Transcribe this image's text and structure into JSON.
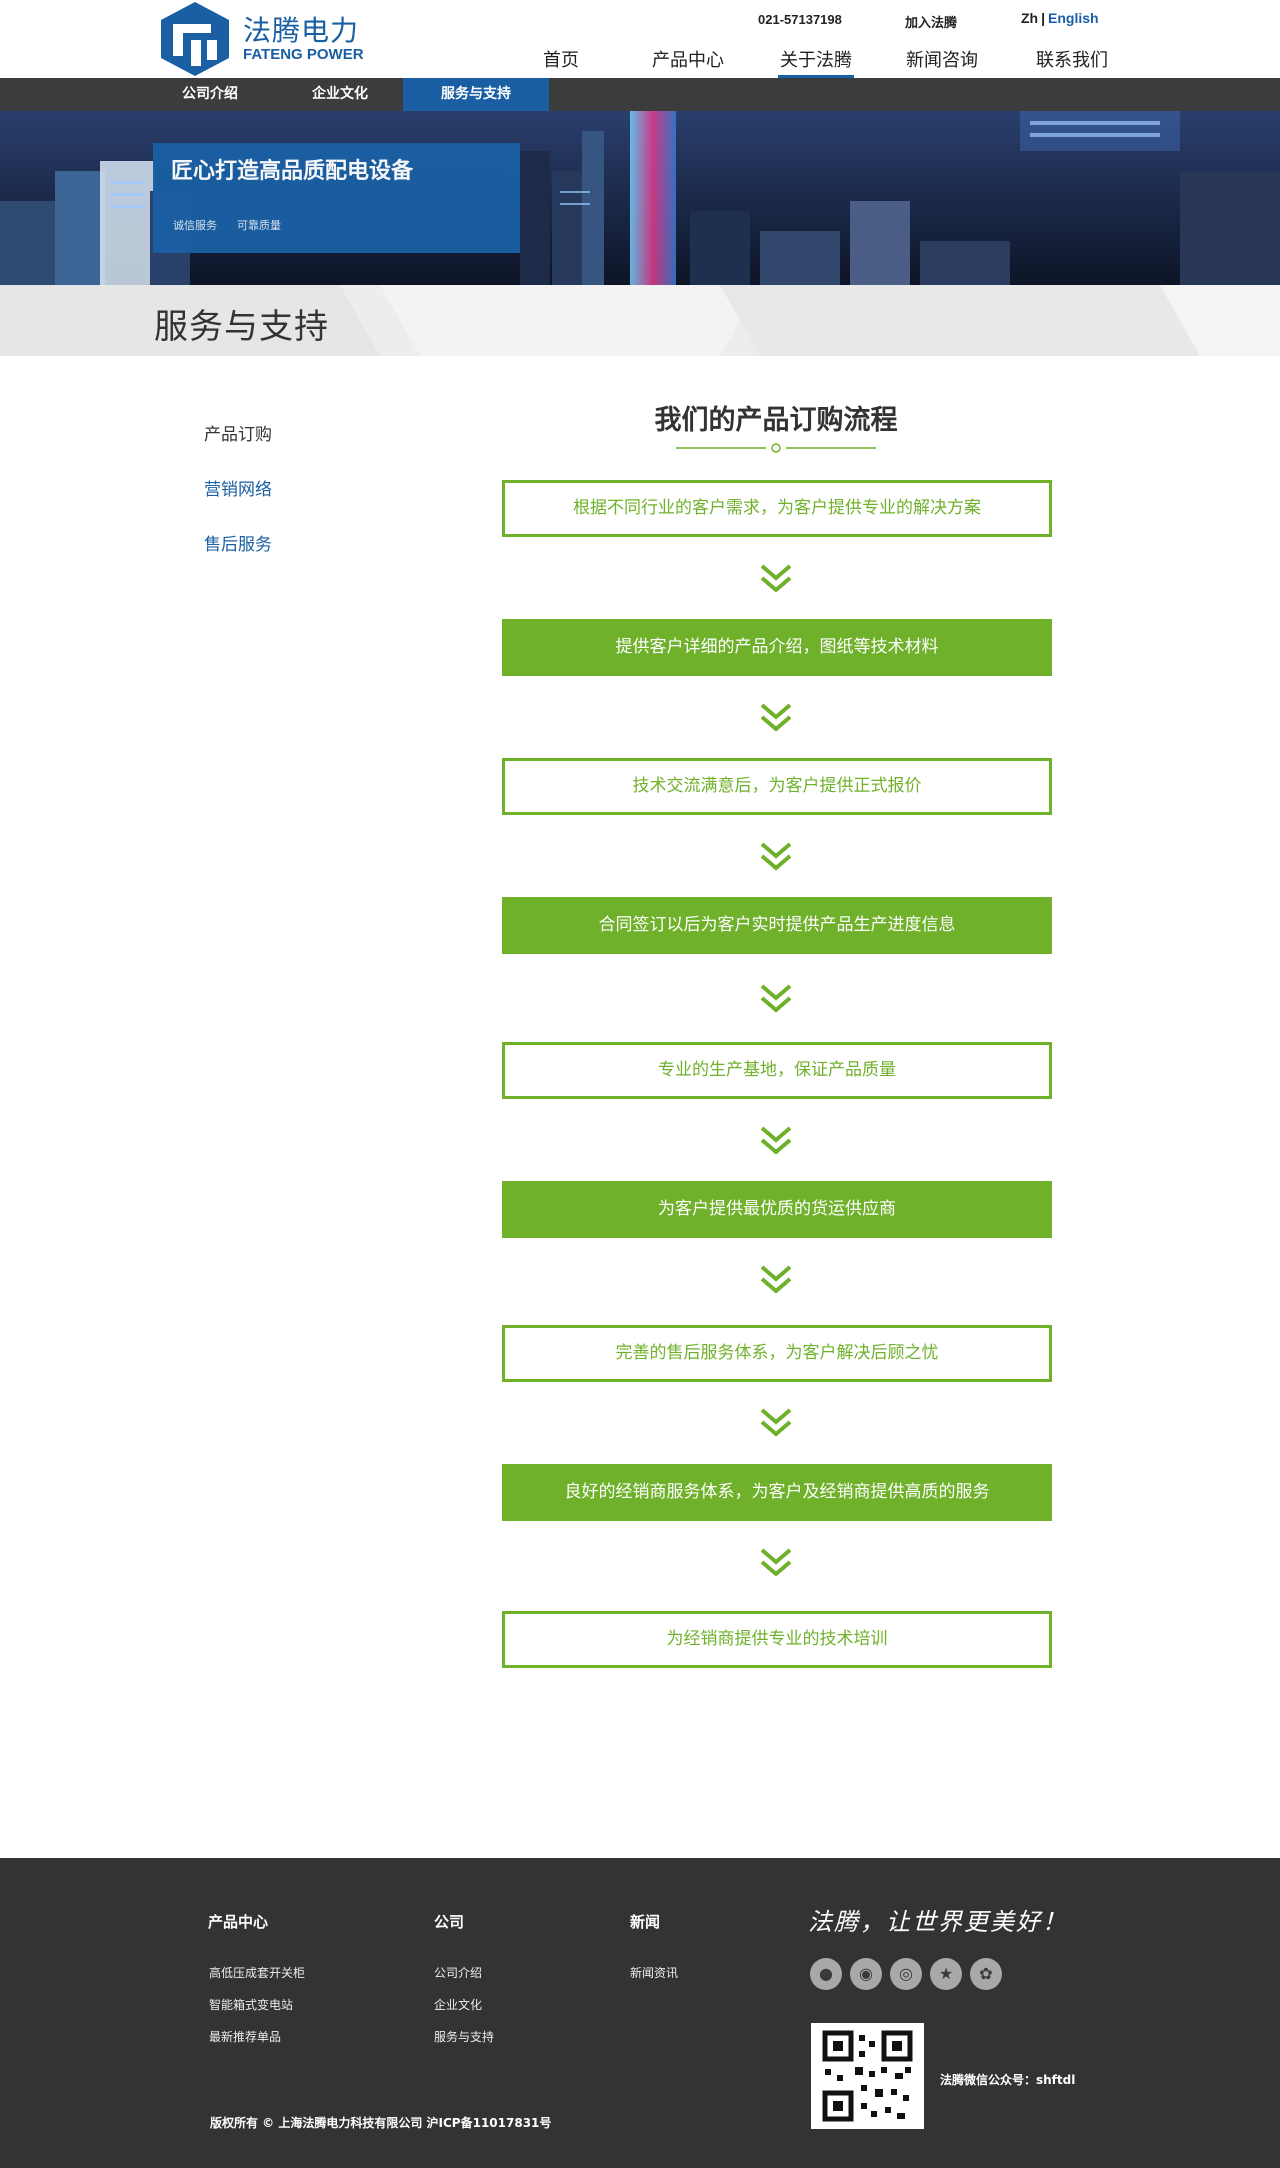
{
  "header": {
    "logo_cn": "法腾电力",
    "logo_en": "FATENG POWER",
    "phone": "021-57137198",
    "join": "加入法腾",
    "lang_zh": "Zh",
    "lang_sep": "|",
    "lang_en": "English",
    "nav": [
      "首页",
      "产品中心",
      "关于法腾",
      "新闻咨询",
      "联系我们"
    ],
    "nav_active": "关于法腾"
  },
  "subnav": {
    "items": [
      "公司介绍",
      "企业文化",
      "服务与支持"
    ],
    "active": "服务与支持"
  },
  "banner": {
    "title": "匠心打造高品质配电设备",
    "tags": [
      "诚信服务",
      "可靠质量"
    ]
  },
  "page_title": "服务与支持",
  "side_menu": [
    "产品订购",
    "营销网络",
    "售后服务"
  ],
  "flow": {
    "title": "我们的产品订购流程",
    "steps": [
      {
        "text": "根据不同行业的客户需求，为客户提供专业的解决方案",
        "style": "outline"
      },
      {
        "text": "提供客户详细的产品介绍，图纸等技术材料",
        "style": "filled"
      },
      {
        "text": "技术交流满意后，为客户提供正式报价",
        "style": "outline"
      },
      {
        "text": "合同签订以后为客户实时提供产品生产进度信息",
        "style": "filled"
      },
      {
        "text": "专业的生产基地，保证产品质量",
        "style": "outline"
      },
      {
        "text": "为客户提供最优质的货运供应商",
        "style": "filled"
      },
      {
        "text": "完善的售后服务体系，为客户解决后顾之忧",
        "style": "outline"
      },
      {
        "text": "良好的经销商服务体系，为客户及经销商提供高质的服务",
        "style": "filled"
      },
      {
        "text": "为经销商提供专业的技术培训",
        "style": "outline"
      }
    ],
    "accent_color": "#6fb12b"
  },
  "footer": {
    "col1": {
      "head": "产品中心",
      "links": [
        "高低压成套开关柜",
        "智能箱式变电站",
        "最新推荐单品"
      ]
    },
    "col2": {
      "head": "公司",
      "links": [
        "公司介绍",
        "企业文化",
        "服务与支持"
      ]
    },
    "col3": {
      "head": "新闻",
      "links": [
        "新闻资讯"
      ]
    },
    "slogan": "法腾，让世界更美好！",
    "social_icons": [
      "qq-icon",
      "wechat-icon",
      "weibo-icon",
      "star-icon",
      "paw-icon"
    ],
    "wechat_text": "法腾微信公众号：shftdl",
    "copyright": "版权所有 © 上海法腾电力科技有限公司 沪ICP备11017831号"
  },
  "colors": {
    "brand_blue": "#1a5fa3",
    "green": "#6fb12b",
    "subnav_bg": "#3c3c3c",
    "footer_bg": "#333333"
  }
}
